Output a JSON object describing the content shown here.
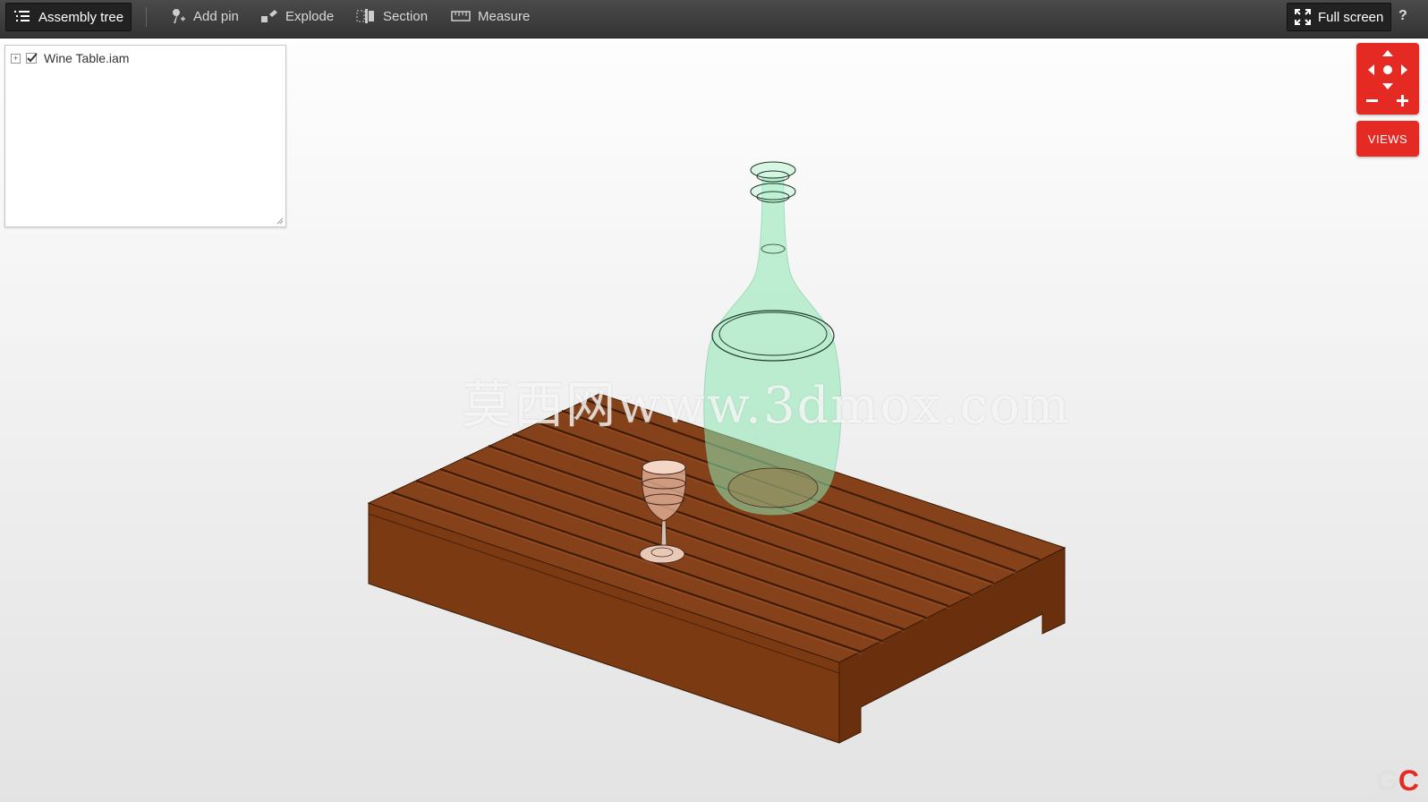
{
  "toolbar": {
    "assembly_tree": "Assembly tree",
    "add_pin": "Add pin",
    "explode": "Explode",
    "section": "Section",
    "measure": "Measure",
    "full_screen": "Full screen",
    "help": "?"
  },
  "tree": {
    "items": [
      {
        "label": "Wine Table.iam",
        "checked": true,
        "expanded": false
      }
    ]
  },
  "viewer": {
    "watermark": "莫西网www.3dmox.com",
    "views_label": "VIEWS",
    "logo_g": "G",
    "logo_c": "C"
  },
  "colors": {
    "accent": "#e42a22",
    "toolbar": "#3a3a3a",
    "table_wood": "#7a3a14",
    "bottle_glass": "#8ee8b4"
  }
}
